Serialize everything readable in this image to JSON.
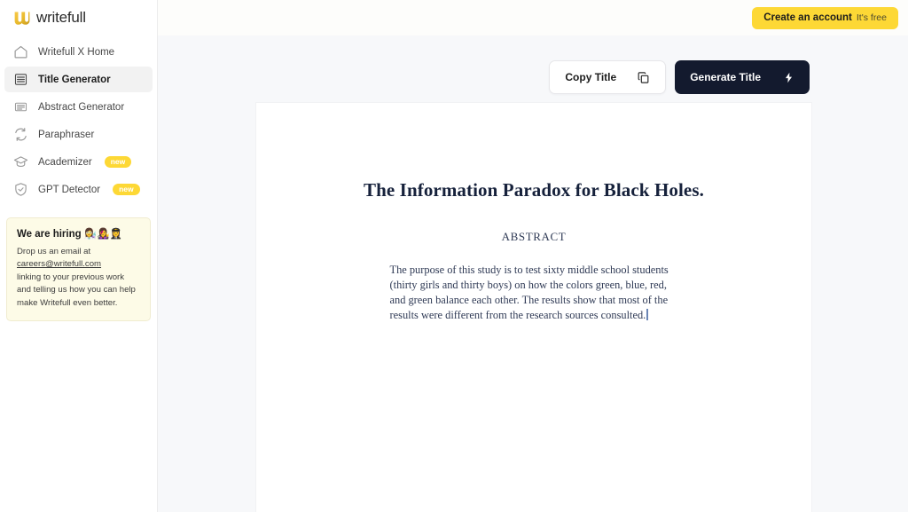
{
  "brand": {
    "name": "writefull",
    "logo_icon": "writefull-w-logo",
    "accent_color": "#FDD835"
  },
  "header": {
    "cta": {
      "label": "Create an account",
      "subtitle": "It's free",
      "background_color": "#FDD835"
    }
  },
  "sidebar": {
    "items": [
      {
        "label": "Writefull X Home",
        "icon": "home-icon",
        "active": false,
        "badge": null
      },
      {
        "label": "Title Generator",
        "icon": "lines-icon",
        "active": true,
        "badge": null
      },
      {
        "label": "Abstract Generator",
        "icon": "lines-icon",
        "active": false,
        "badge": null
      },
      {
        "label": "Paraphraser",
        "icon": "refresh-cycle-icon",
        "active": false,
        "badge": null
      },
      {
        "label": "Academizer",
        "icon": "graduation-cap-icon",
        "active": false,
        "badge": "new"
      },
      {
        "label": "GPT Detector",
        "icon": "shield-check-icon",
        "active": false,
        "badge": "new"
      }
    ],
    "hiring": {
      "title": "We are hiring 👩‍🔬👩‍🎤👩‍✈️",
      "line1": "Drop us an email at",
      "email": "careers@writefull.com",
      "line2": "linking to your previous work and telling us how you can help make Writefull even better.",
      "background_color": "#FDFBE7"
    }
  },
  "toolbar": {
    "copy_title": {
      "label": "Copy Title",
      "icon": "copy-icon"
    },
    "generate_title": {
      "label": "Generate Title",
      "icon": "lightning-bolt-icon",
      "background_color": "#131A2E"
    }
  },
  "document": {
    "title": "The Information Paradox for Black Holes.",
    "abstract_heading": "ABSTRACT",
    "abstract_text": "The purpose of this study is to test sixty middle school students (thirty girls and thirty boys) on how the colors green, blue, red, and green balance each other. The results show that most of the results were different from the research sources consulted.",
    "caret_visible": true
  }
}
